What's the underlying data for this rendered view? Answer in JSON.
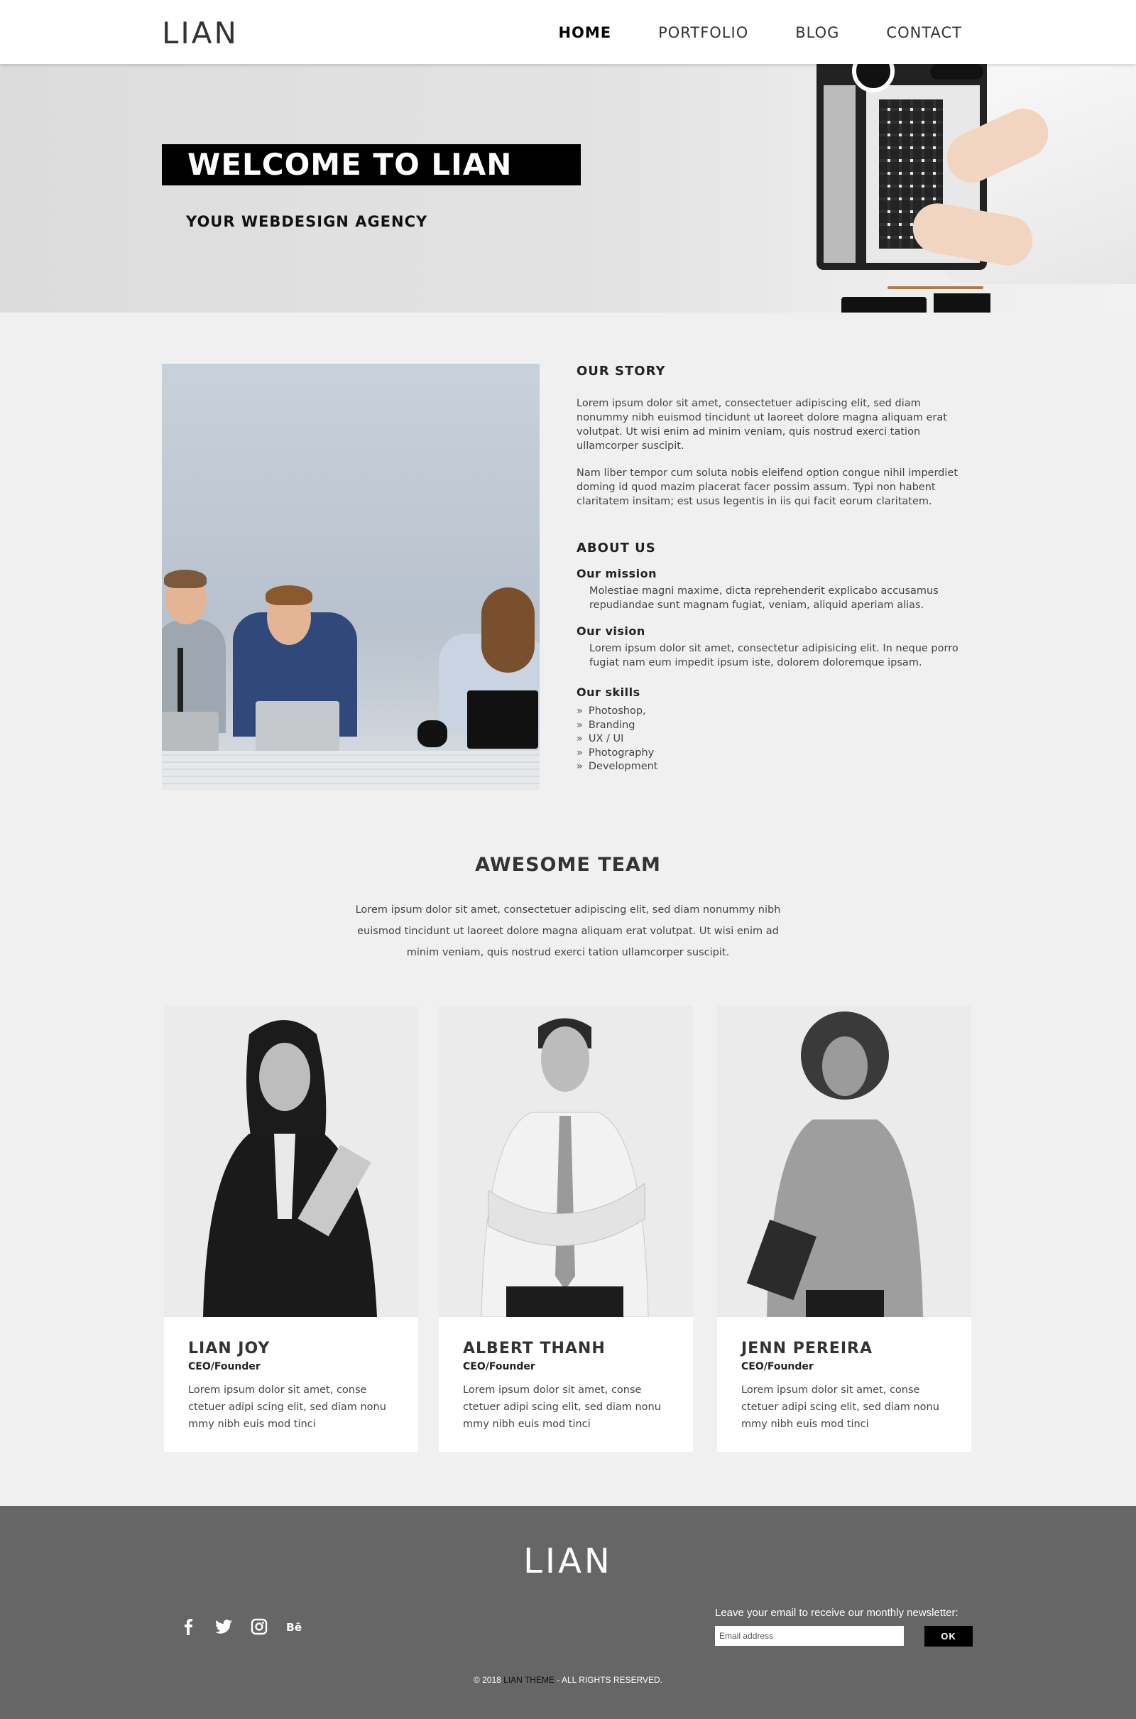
{
  "header": {
    "logo": "LIAN",
    "nav": [
      "HOME",
      "PORTFOLIO",
      "BLOG",
      "CONTACT"
    ]
  },
  "hero": {
    "title": "WELCOME TO LIAN",
    "subtitle": "YOUR WEBDESIGN AGENCY"
  },
  "story": {
    "heading": "OUR STORY",
    "para1": "Lorem ipsum dolor sit amet, consectetuer adipiscing elit, sed diam nonummy nibh euismod tincidunt ut laoreet dolore magna aliquam erat volutpat. Ut wisi enim ad minim veniam, quis nostrud exerci tation ullamcorper suscipit.",
    "para2": "Nam liber tempor cum soluta nobis eleifend option congue nihil imperdiet doming id quod mazim placerat facer possim assum. Typi non habent claritatem insitam; est usus legentis in iis qui facit eorum claritatem."
  },
  "about": {
    "heading": "ABOUT US",
    "mission_label": "Our mission",
    "mission_text": "Molestiae magni maxime, dicta reprehenderit explicabo accusamus repudiandae sunt magnam fugiat, veniam, aliquid aperiam alias.",
    "vision_label": "Our vision",
    "vision_text": "Lorem ipsum dolor sit amet, consectetur adipisicing elit. In neque porro fugiat nam eum impedit ipsum iste, dolorem doloremque ipsam.",
    "skills_label": "Our skills",
    "skills": [
      "Photoshop,",
      "Branding",
      "UX / UI",
      "Photography",
      "Development"
    ]
  },
  "team": {
    "title": "AWESOME TEAM",
    "description": "Lorem ipsum dolor sit amet, consectetuer adipiscing elit, sed diam nonummy nibh euismod tincidunt ut laoreet dolore magna aliquam erat volutpat. Ut wisi enim ad minim veniam, quis nostrud exerci tation ullamcorper suscipit.",
    "members": [
      {
        "name": "LIAN JOY",
        "role": "CEO/Founder",
        "bio": "Lorem ipsum dolor sit amet, conse ctetuer adipi scing elit, sed diam nonu mmy nibh euis mod tinci"
      },
      {
        "name": "ALBERT THANH",
        "role": "CEO/Founder",
        "bio": "Lorem ipsum dolor sit amet, conse ctetuer adipi scing elit, sed diam nonu mmy nibh euis mod tinci"
      },
      {
        "name": "JENN PEREIRA",
        "role": "CEO/Founder",
        "bio": "Lorem ipsum dolor sit amet, conse ctetuer adipi scing elit, sed diam nonu mmy nibh euis mod tinci"
      }
    ]
  },
  "footer": {
    "logo": "LIAN",
    "socials": [
      "facebook-icon",
      "twitter-icon",
      "instagram-icon",
      "behance-icon"
    ],
    "newsletter_label": "Leave your email to receive our monthly newsletter:",
    "email_placeholder": "Email address",
    "ok_label": "OK",
    "copyright_prefix": "© 2018",
    "copyright_brand": "LIAN THEME",
    "copyright_suffix": "- ALL RIGHTS RESERVED."
  },
  "colors": {
    "background": "#f0f0f0",
    "footer": "#666666",
    "hero_bar": "#000000",
    "text": "#333333"
  }
}
